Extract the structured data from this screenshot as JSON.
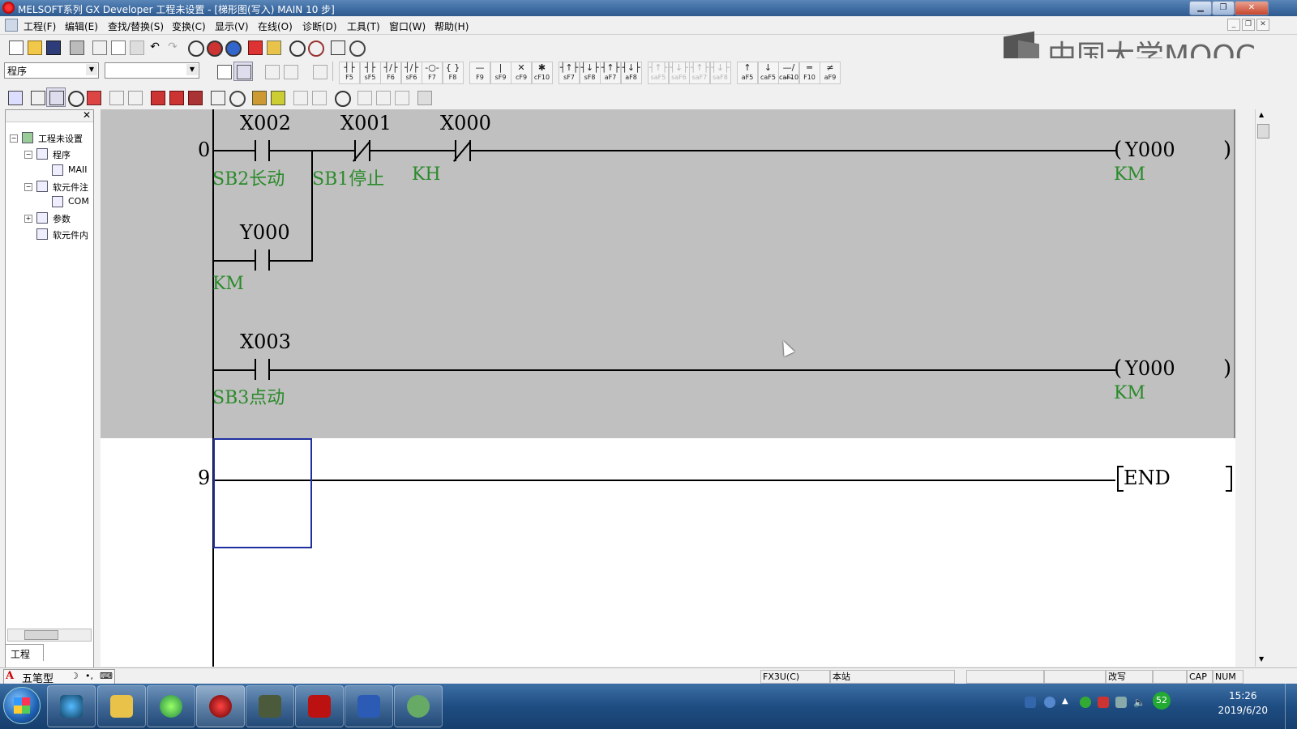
{
  "window": {
    "title": "MELSOFT系列 GX Developer 工程未设置 - [梯形图(写入)    MAIN    10 步]"
  },
  "menu": [
    "工程(F)",
    "编辑(E)",
    "查找/替换(S)",
    "变换(C)",
    "显示(V)",
    "在线(O)",
    "诊断(D)",
    "工具(T)",
    "窗口(W)",
    "帮助(H)"
  ],
  "watermark": "中国大学MOOC",
  "toolbar": {
    "data_type": "程序",
    "device_select": "",
    "fkeys": [
      {
        "sym": "┤├",
        "label": "F5"
      },
      {
        "sym": "┤├",
        "label": "sF5"
      },
      {
        "sym": "┤/├",
        "label": "F6"
      },
      {
        "sym": "┤/├",
        "label": "sF6"
      },
      {
        "sym": "-○-",
        "label": "F7"
      },
      {
        "sym": "{ }",
        "label": "F8"
      },
      {
        "sym": "—",
        "label": "F9"
      },
      {
        "sym": "|",
        "label": "sF9"
      },
      {
        "sym": "✕",
        "label": "cF9"
      },
      {
        "sym": "✱",
        "label": "cF10"
      },
      {
        "sym": "┤↑├",
        "label": "sF7"
      },
      {
        "sym": "┤↓├",
        "label": "sF8"
      },
      {
        "sym": "┤↑├",
        "label": "aF7"
      },
      {
        "sym": "┤↓├",
        "label": "aF8"
      },
      {
        "sym": "┤↑├",
        "label": "saF5"
      },
      {
        "sym": "┤↓├",
        "label": "saF6"
      },
      {
        "sym": "┤↑├",
        "label": "saF7"
      },
      {
        "sym": "┤↓├",
        "label": "saF8"
      },
      {
        "sym": "↑",
        "label": "aF5"
      },
      {
        "sym": "↓",
        "label": "caF5"
      },
      {
        "sym": "—/—",
        "label": "caF10"
      },
      {
        "sym": "═",
        "label": "F10"
      },
      {
        "sym": "≠",
        "label": "aF9"
      }
    ]
  },
  "tree": {
    "root": "工程未设置",
    "program": "程序",
    "main": "MAII",
    "device_comment": "软元件注",
    "comment": "COM",
    "params": "参数",
    "device_memory": "软元件内",
    "tab": "工程"
  },
  "ladder": {
    "rungs": [
      {
        "step": "0",
        "contacts": [
          {
            "device": "X002",
            "comment": "SB2长动",
            "type": "NO"
          },
          {
            "device": "X001",
            "comment": "SB1停止",
            "type": "NC"
          },
          {
            "device": "X000",
            "comment": "KH",
            "type": "NC"
          }
        ],
        "parallel": {
          "device": "Y000",
          "comment": "KM",
          "type": "NO"
        },
        "coil": {
          "device": "Y000",
          "comment": "KM"
        }
      },
      {
        "step": "",
        "contacts": [
          {
            "device": "X003",
            "comment": "SB3点动",
            "type": "NO"
          }
        ],
        "coil": {
          "device": "Y000",
          "comment": "KM"
        }
      },
      {
        "step": "9",
        "coil": {
          "device": "END",
          "comment": ""
        }
      }
    ]
  },
  "ime": {
    "indicator": "A",
    "mode": "五笔型"
  },
  "status": {
    "plc": "FX3U(C)",
    "station": "本站",
    "mode": "改写",
    "cap": "CAP",
    "num": "NUM"
  },
  "clock": {
    "time": "15:26",
    "date": "2019/6/20"
  },
  "tray": {
    "badge": "52"
  }
}
